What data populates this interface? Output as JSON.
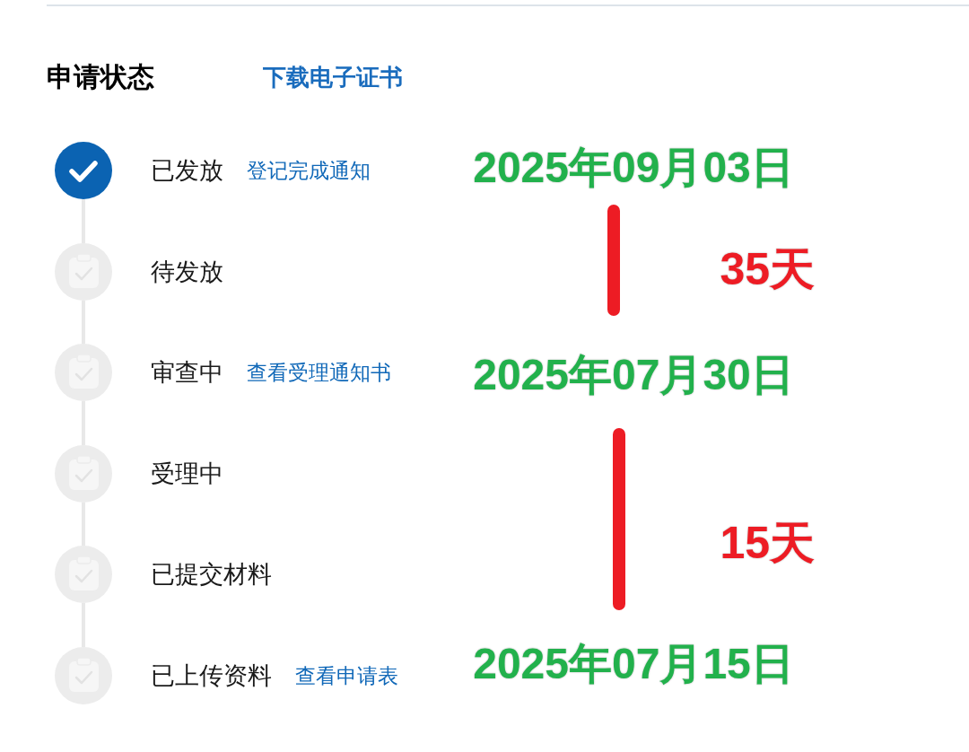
{
  "header": {
    "title": "申请状态",
    "link": "下载电子证书"
  },
  "steps": [
    {
      "label": "已发放",
      "link": "登记完成通知",
      "done": true
    },
    {
      "label": "待发放",
      "done": false
    },
    {
      "label": "审查中",
      "link": "查看受理通知书",
      "done": false
    },
    {
      "label": "受理中",
      "done": false
    },
    {
      "label": "已提交材料",
      "done": false
    },
    {
      "label": "已上传资料",
      "link": "查看申请表",
      "done": false
    }
  ],
  "annotations": [
    {
      "kind": "date",
      "text": "2025年09月03日"
    },
    {
      "kind": "interval",
      "text": "35天"
    },
    {
      "kind": "date",
      "text": "2025年07月30日"
    },
    {
      "kind": "interval",
      "text": "15天"
    },
    {
      "kind": "date",
      "text": "2025年07月15日"
    }
  ]
}
